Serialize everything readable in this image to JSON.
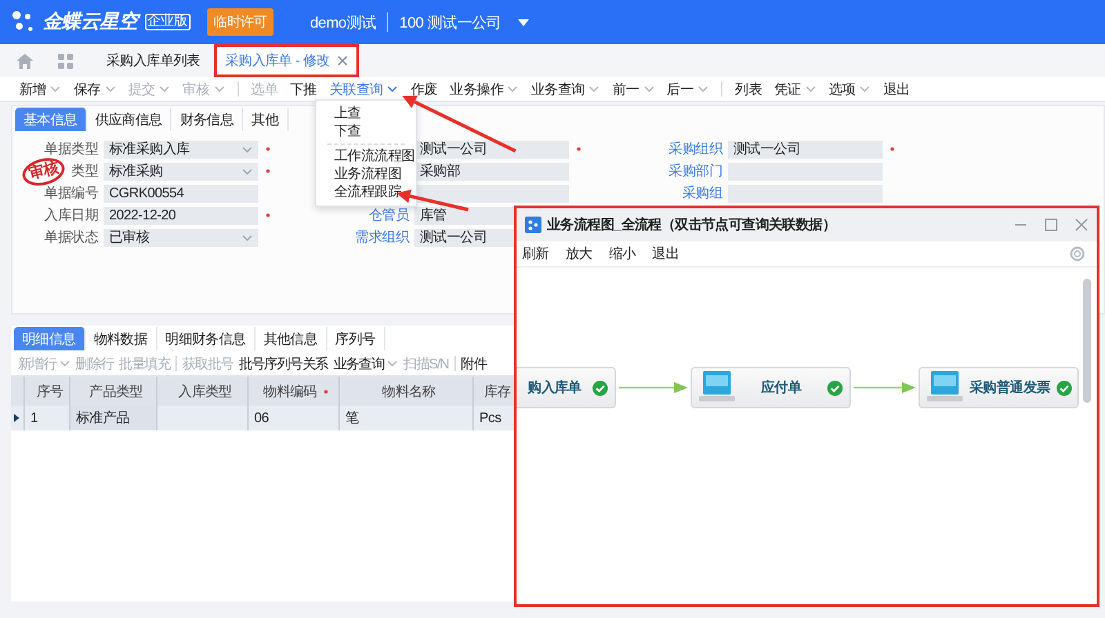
{
  "header": {
    "brand": "金蝶云星空",
    "edition": "企业版",
    "license": "临时许可",
    "user": "demo测试",
    "org": "100 测试一公司"
  },
  "tabs": [
    {
      "label": "采购入库单列表",
      "selected": false,
      "closable": false
    },
    {
      "label": "采购入库单 - 修改",
      "selected": true,
      "closable": true
    }
  ],
  "toolbar": [
    {
      "kind": "button",
      "label": "新增",
      "dropdown": true,
      "disabled": false,
      "active": false
    },
    {
      "kind": "button",
      "label": "保存",
      "dropdown": true,
      "disabled": false,
      "active": false
    },
    {
      "kind": "button",
      "label": "提交",
      "dropdown": true,
      "disabled": true,
      "active": false
    },
    {
      "kind": "button",
      "label": "审核",
      "dropdown": true,
      "disabled": true,
      "active": false
    },
    {
      "kind": "separator"
    },
    {
      "kind": "button",
      "label": "选单",
      "dropdown": false,
      "disabled": true,
      "active": false
    },
    {
      "kind": "button",
      "label": "下推",
      "dropdown": false,
      "disabled": false,
      "active": false
    },
    {
      "kind": "button",
      "label": "关联查询",
      "dropdown": true,
      "disabled": false,
      "active": true
    },
    {
      "kind": "button",
      "label": "作废",
      "dropdown": false,
      "disabled": false,
      "active": false
    },
    {
      "kind": "button",
      "label": "业务操作",
      "dropdown": true,
      "disabled": false,
      "active": false
    },
    {
      "kind": "button",
      "label": "业务查询",
      "dropdown": true,
      "disabled": false,
      "active": false
    },
    {
      "kind": "button",
      "label": "前一",
      "dropdown": true,
      "disabled": false,
      "active": false
    },
    {
      "kind": "button",
      "label": "后一",
      "dropdown": true,
      "disabled": false,
      "active": false
    },
    {
      "kind": "separator"
    },
    {
      "kind": "button",
      "label": "列表",
      "dropdown": false,
      "disabled": false,
      "active": false
    },
    {
      "kind": "button",
      "label": "凭证",
      "dropdown": true,
      "disabled": false,
      "active": false
    },
    {
      "kind": "button",
      "label": "选项",
      "dropdown": true,
      "disabled": false,
      "active": false
    },
    {
      "kind": "button",
      "label": "退出",
      "dropdown": false,
      "disabled": false,
      "active": false
    }
  ],
  "menu": [
    {
      "kind": "item",
      "label": "上查"
    },
    {
      "kind": "item",
      "label": "下查"
    },
    {
      "kind": "separator"
    },
    {
      "kind": "item",
      "label": "工作流流程图"
    },
    {
      "kind": "item",
      "label": "业务流程图"
    },
    {
      "kind": "item",
      "label": "全流程跟踪"
    }
  ],
  "form": {
    "tabs": [
      {
        "label": "基本信息",
        "selected": true
      },
      {
        "label": "供应商信息",
        "selected": false
      },
      {
        "label": "财务信息",
        "selected": false
      },
      {
        "label": "其他",
        "selected": false
      }
    ],
    "stamp": "审核",
    "rows": [
      [
        {
          "label": "单据类型",
          "link": false,
          "value": "标准采购入库",
          "kind": "select",
          "required": true
        },
        {
          "value": "测试一公司",
          "kind": "text",
          "required": true
        },
        {
          "label": "采购组织",
          "link": true,
          "value": "测试一公司",
          "kind": "text",
          "required": true
        }
      ],
      [
        {
          "label": "类型",
          "link": false,
          "value": "标准采购",
          "kind": "select",
          "required": true
        },
        {
          "value": "采购部",
          "kind": "text",
          "required": false
        },
        {
          "label": "采购部门",
          "link": true,
          "kind": "text",
          "required": false
        }
      ],
      [
        {
          "label": "单据编号",
          "link": false,
          "value": "CGRK00554",
          "kind": "text",
          "required": false
        },
        {
          "kind": "text",
          "required": false
        },
        {
          "label": "采购组",
          "link": true,
          "kind": "text",
          "required": false
        }
      ],
      [
        {
          "label": "入库日期",
          "link": false,
          "value": "2022-12-20",
          "kind": "text",
          "required": true
        },
        {
          "label": "仓管员",
          "link": true,
          "value": "库管",
          "kind": "text",
          "required": false
        }
      ],
      [
        {
          "label": "单据状态",
          "link": false,
          "value": "已审核",
          "kind": "select",
          "required": false
        },
        {
          "label": "需求组织",
          "link": true,
          "value": "测试一公司",
          "kind": "text",
          "required": false
        }
      ]
    ]
  },
  "detail": {
    "tabs": [
      {
        "label": "明细信息",
        "selected": true
      },
      {
        "label": "物料数据",
        "selected": false
      },
      {
        "label": "明细财务信息",
        "selected": false
      },
      {
        "label": "其他信息",
        "selected": false
      },
      {
        "label": "序列号",
        "selected": false
      }
    ],
    "toolbar": [
      {
        "kind": "button",
        "label": "新增行",
        "dropdown": true,
        "disabled": true
      },
      {
        "kind": "button",
        "label": "删除行",
        "dropdown": false,
        "disabled": true
      },
      {
        "kind": "button",
        "label": "批量填充",
        "dropdown": false,
        "disabled": true
      },
      {
        "kind": "separator"
      },
      {
        "kind": "button",
        "label": "获取批号",
        "dropdown": false,
        "disabled": true
      },
      {
        "kind": "button",
        "label": "批号序列号关系",
        "dropdown": false,
        "disabled": false
      },
      {
        "kind": "button",
        "label": "业务查询",
        "dropdown": true,
        "disabled": false
      },
      {
        "kind": "button",
        "label": "扫描S/N",
        "dropdown": false,
        "disabled": true
      },
      {
        "kind": "separator"
      },
      {
        "kind": "button",
        "label": "附件",
        "dropdown": false,
        "disabled": false
      }
    ],
    "columns": [
      {
        "label": "序号",
        "required": false
      },
      {
        "label": "产品类型",
        "required": false
      },
      {
        "label": "入库类型",
        "required": false
      },
      {
        "label": "物料编码",
        "required": true
      },
      {
        "label": "物料名称",
        "required": false
      },
      {
        "label": "库存",
        "required": false
      }
    ],
    "rows": [
      {
        "current": true,
        "cells": [
          "1",
          "标准产品",
          "",
          "06",
          "笔",
          "Pcs"
        ]
      }
    ]
  },
  "popup": {
    "title": "业务流程图_全流程（双击节点可查询关联数据）",
    "toolbar": [
      "刷新",
      "放大",
      "缩小",
      "退出"
    ],
    "nodes": [
      {
        "label": "购入库单",
        "done": true
      },
      {
        "label": "应付单",
        "done": true
      },
      {
        "label": "采购普通发票",
        "done": true
      }
    ]
  }
}
